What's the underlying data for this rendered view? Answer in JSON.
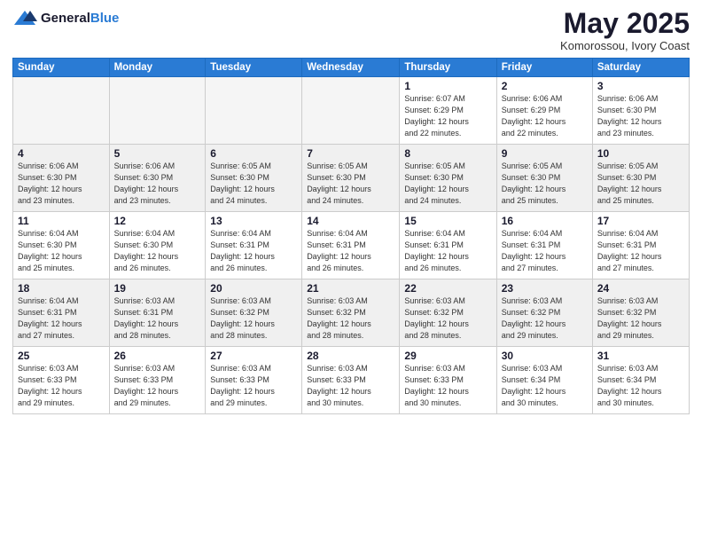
{
  "header": {
    "logo": {
      "general": "General",
      "blue": "Blue"
    },
    "title": "May 2025",
    "location": "Komorossou, Ivory Coast"
  },
  "calendar": {
    "weekdays": [
      "Sunday",
      "Monday",
      "Tuesday",
      "Wednesday",
      "Thursday",
      "Friday",
      "Saturday"
    ],
    "weeks": [
      [
        {
          "day": "",
          "info": "",
          "empty": true
        },
        {
          "day": "",
          "info": "",
          "empty": true
        },
        {
          "day": "",
          "info": "",
          "empty": true
        },
        {
          "day": "",
          "info": "",
          "empty": true
        },
        {
          "day": "1",
          "info": "Sunrise: 6:07 AM\nSunset: 6:29 PM\nDaylight: 12 hours\nand 22 minutes.",
          "empty": false
        },
        {
          "day": "2",
          "info": "Sunrise: 6:06 AM\nSunset: 6:29 PM\nDaylight: 12 hours\nand 22 minutes.",
          "empty": false
        },
        {
          "day": "3",
          "info": "Sunrise: 6:06 AM\nSunset: 6:30 PM\nDaylight: 12 hours\nand 23 minutes.",
          "empty": false
        }
      ],
      [
        {
          "day": "4",
          "info": "Sunrise: 6:06 AM\nSunset: 6:30 PM\nDaylight: 12 hours\nand 23 minutes.",
          "empty": false
        },
        {
          "day": "5",
          "info": "Sunrise: 6:06 AM\nSunset: 6:30 PM\nDaylight: 12 hours\nand 23 minutes.",
          "empty": false
        },
        {
          "day": "6",
          "info": "Sunrise: 6:05 AM\nSunset: 6:30 PM\nDaylight: 12 hours\nand 24 minutes.",
          "empty": false
        },
        {
          "day": "7",
          "info": "Sunrise: 6:05 AM\nSunset: 6:30 PM\nDaylight: 12 hours\nand 24 minutes.",
          "empty": false
        },
        {
          "day": "8",
          "info": "Sunrise: 6:05 AM\nSunset: 6:30 PM\nDaylight: 12 hours\nand 24 minutes.",
          "empty": false
        },
        {
          "day": "9",
          "info": "Sunrise: 6:05 AM\nSunset: 6:30 PM\nDaylight: 12 hours\nand 25 minutes.",
          "empty": false
        },
        {
          "day": "10",
          "info": "Sunrise: 6:05 AM\nSunset: 6:30 PM\nDaylight: 12 hours\nand 25 minutes.",
          "empty": false
        }
      ],
      [
        {
          "day": "11",
          "info": "Sunrise: 6:04 AM\nSunset: 6:30 PM\nDaylight: 12 hours\nand 25 minutes.",
          "empty": false
        },
        {
          "day": "12",
          "info": "Sunrise: 6:04 AM\nSunset: 6:30 PM\nDaylight: 12 hours\nand 26 minutes.",
          "empty": false
        },
        {
          "day": "13",
          "info": "Sunrise: 6:04 AM\nSunset: 6:31 PM\nDaylight: 12 hours\nand 26 minutes.",
          "empty": false
        },
        {
          "day": "14",
          "info": "Sunrise: 6:04 AM\nSunset: 6:31 PM\nDaylight: 12 hours\nand 26 minutes.",
          "empty": false
        },
        {
          "day": "15",
          "info": "Sunrise: 6:04 AM\nSunset: 6:31 PM\nDaylight: 12 hours\nand 26 minutes.",
          "empty": false
        },
        {
          "day": "16",
          "info": "Sunrise: 6:04 AM\nSunset: 6:31 PM\nDaylight: 12 hours\nand 27 minutes.",
          "empty": false
        },
        {
          "day": "17",
          "info": "Sunrise: 6:04 AM\nSunset: 6:31 PM\nDaylight: 12 hours\nand 27 minutes.",
          "empty": false
        }
      ],
      [
        {
          "day": "18",
          "info": "Sunrise: 6:04 AM\nSunset: 6:31 PM\nDaylight: 12 hours\nand 27 minutes.",
          "empty": false
        },
        {
          "day": "19",
          "info": "Sunrise: 6:03 AM\nSunset: 6:31 PM\nDaylight: 12 hours\nand 28 minutes.",
          "empty": false
        },
        {
          "day": "20",
          "info": "Sunrise: 6:03 AM\nSunset: 6:32 PM\nDaylight: 12 hours\nand 28 minutes.",
          "empty": false
        },
        {
          "day": "21",
          "info": "Sunrise: 6:03 AM\nSunset: 6:32 PM\nDaylight: 12 hours\nand 28 minutes.",
          "empty": false
        },
        {
          "day": "22",
          "info": "Sunrise: 6:03 AM\nSunset: 6:32 PM\nDaylight: 12 hours\nand 28 minutes.",
          "empty": false
        },
        {
          "day": "23",
          "info": "Sunrise: 6:03 AM\nSunset: 6:32 PM\nDaylight: 12 hours\nand 29 minutes.",
          "empty": false
        },
        {
          "day": "24",
          "info": "Sunrise: 6:03 AM\nSunset: 6:32 PM\nDaylight: 12 hours\nand 29 minutes.",
          "empty": false
        }
      ],
      [
        {
          "day": "25",
          "info": "Sunrise: 6:03 AM\nSunset: 6:33 PM\nDaylight: 12 hours\nand 29 minutes.",
          "empty": false
        },
        {
          "day": "26",
          "info": "Sunrise: 6:03 AM\nSunset: 6:33 PM\nDaylight: 12 hours\nand 29 minutes.",
          "empty": false
        },
        {
          "day": "27",
          "info": "Sunrise: 6:03 AM\nSunset: 6:33 PM\nDaylight: 12 hours\nand 29 minutes.",
          "empty": false
        },
        {
          "day": "28",
          "info": "Sunrise: 6:03 AM\nSunset: 6:33 PM\nDaylight: 12 hours\nand 30 minutes.",
          "empty": false
        },
        {
          "day": "29",
          "info": "Sunrise: 6:03 AM\nSunset: 6:33 PM\nDaylight: 12 hours\nand 30 minutes.",
          "empty": false
        },
        {
          "day": "30",
          "info": "Sunrise: 6:03 AM\nSunset: 6:34 PM\nDaylight: 12 hours\nand 30 minutes.",
          "empty": false
        },
        {
          "day": "31",
          "info": "Sunrise: 6:03 AM\nSunset: 6:34 PM\nDaylight: 12 hours\nand 30 minutes.",
          "empty": false
        }
      ]
    ]
  }
}
